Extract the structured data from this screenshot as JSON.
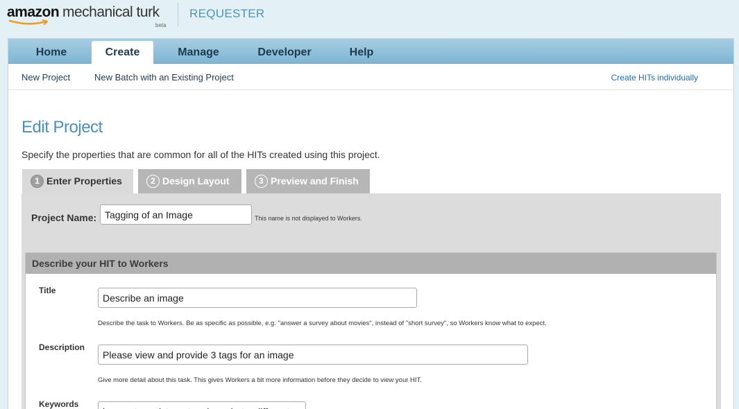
{
  "header": {
    "logo_amazon": "amazon",
    "logo_mturk": "mechanical turk",
    "logo_beta": "beta",
    "section": "REQUESTER"
  },
  "nav": {
    "tabs": [
      {
        "label": "Home"
      },
      {
        "label": "Create"
      },
      {
        "label": "Manage"
      },
      {
        "label": "Developer"
      },
      {
        "label": "Help"
      }
    ],
    "active_tab": "Create"
  },
  "subnav": {
    "new_project": "New Project",
    "new_batch": "New Batch with an Existing Project",
    "create_hits": "Create HITs individually"
  },
  "page": {
    "title": "Edit Project",
    "description": "Specify the properties that are common for all of the HITs created using this project."
  },
  "steps": [
    {
      "num": "1",
      "label": "Enter Properties"
    },
    {
      "num": "2",
      "label": "Design Layout"
    },
    {
      "num": "3",
      "label": "Preview and Finish"
    }
  ],
  "project_name": {
    "label": "Project Name:",
    "value": "Tagging of an Image",
    "hint": "This name is not displayed to Workers."
  },
  "describe": {
    "header": "Describe your HIT to Workers",
    "fields": [
      {
        "label": "Title",
        "value": "Describe an image",
        "hint": "Describe the task to Workers. Be as specific as possible, e.g. \"answer a survey about movies\", instead of \"short survey\", so Workers know what to expect."
      },
      {
        "label": "Description",
        "value": "Please view and provide 3 tags for an image",
        "hint": "Give more detail about this task. This gives Workers a bit more information before they decide to view your HIT."
      },
      {
        "label": "Keywords",
        "value": "image, tag, picture, tagging, photo, different"
      }
    ]
  },
  "colors": {
    "accent": "#4a90bd",
    "tabbar": "#8fc0dc",
    "page_bg": "#e3f0f6"
  }
}
